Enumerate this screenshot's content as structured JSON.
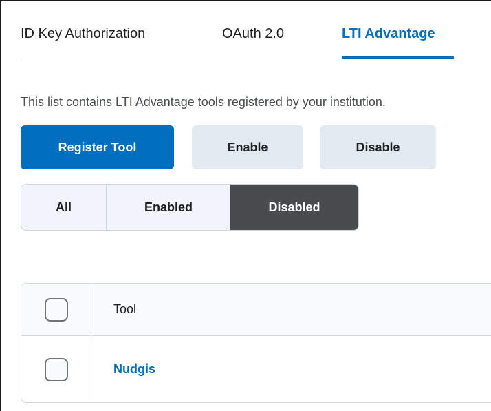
{
  "tabs": [
    {
      "label": "ID Key Authorization",
      "active": false
    },
    {
      "label": "OAuth 2.0",
      "active": false
    },
    {
      "label": "LTI Advantage",
      "active": true
    }
  ],
  "description": "This list contains LTI Advantage tools registered by your institution.",
  "buttons": {
    "register": "Register Tool",
    "enable": "Enable",
    "disable": "Disable"
  },
  "filter": {
    "options": [
      "All",
      "Enabled",
      "Disabled"
    ],
    "selected": "Disabled"
  },
  "table": {
    "header": "Tool",
    "rows": [
      {
        "name": "Nudgis",
        "checked": false
      }
    ]
  },
  "colors": {
    "accent": "#006fbf",
    "selected_segment": "#494c4e",
    "secondary_button": "#e3e9f1"
  }
}
